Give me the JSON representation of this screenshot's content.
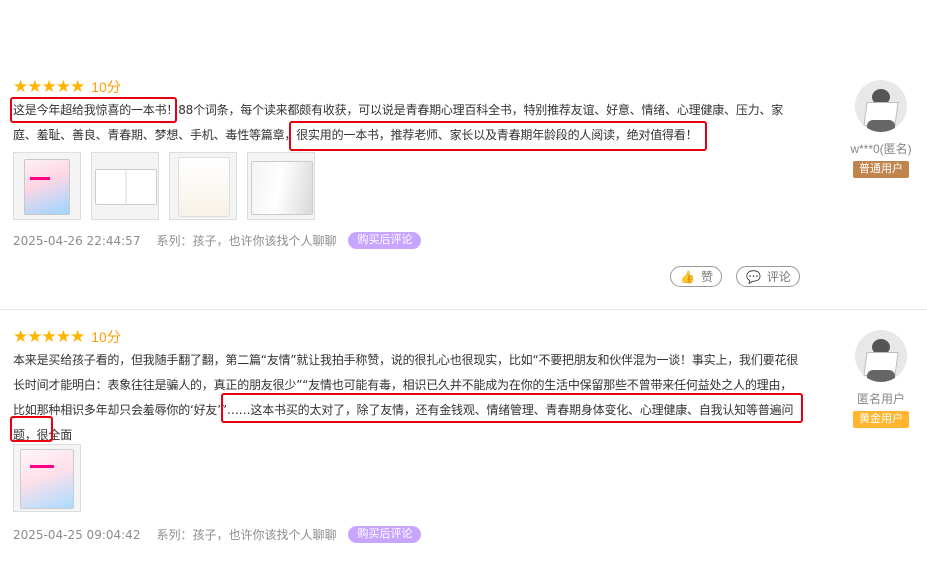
{
  "reviews": [
    {
      "stars": 5,
      "score": "10分",
      "content": "这是今年超给我惊喜的一本书！88个词条，每个读来都颇有收获，可以说是青春期心理百科全书，特别推荐友谊、好意、情绪、心理健康、压力、家庭、羞耻、善良、青春期、梦想、手机、毒性等篇章，很实用的一本书，推荐老师、家长以及青春期年龄段的人阅读，绝对值得看！",
      "date": "2025-04-26 22:44:57",
      "series": "系列：孩子，也许你该找个人聊聊",
      "badge": "购买后评论",
      "like_label": "赞",
      "comment_label": "评论",
      "user": {
        "name": "w***0(匿名)",
        "level": "普通用户"
      },
      "images": [
        "book-cover",
        "book-spread",
        "book-page",
        "book-open"
      ]
    },
    {
      "stars": 5,
      "score": "10分",
      "content": "本来是买给孩子看的，但我随手翻了翻，第二篇“友情”就让我拍手称赞，说的很扎心也很现实，比如“不要把朋友和伙伴混为一谈！事实上，我们要花很长时间才能明白：表象往往是骗人的，真正的朋友很少”“友情也可能有毒，相识已久并不能成为在你的生活中保留那些不曾带来任何益处之人的理由，比如那种相识多年却只会羞辱你的‘好友’”……这本书买的太对了，除了友情，还有金钱观、情绪管理、青春期身体变化、心理健康、自我认知等普遍问题，很全面",
      "date": "2025-04-25 09:04:42",
      "series": "系列：孩子，也许你该找个人聊聊",
      "badge": "购买后评论",
      "user": {
        "name": "匿名用户",
        "level": "黄金用户"
      },
      "images": [
        "book-cover"
      ]
    }
  ],
  "colors": {
    "star": "#ffb400",
    "score": "#ff9d00",
    "highlight": "#e60012",
    "badge": "#c8a6ff",
    "level_normal": "#c0854c",
    "level_gold": "#ffb52e"
  }
}
